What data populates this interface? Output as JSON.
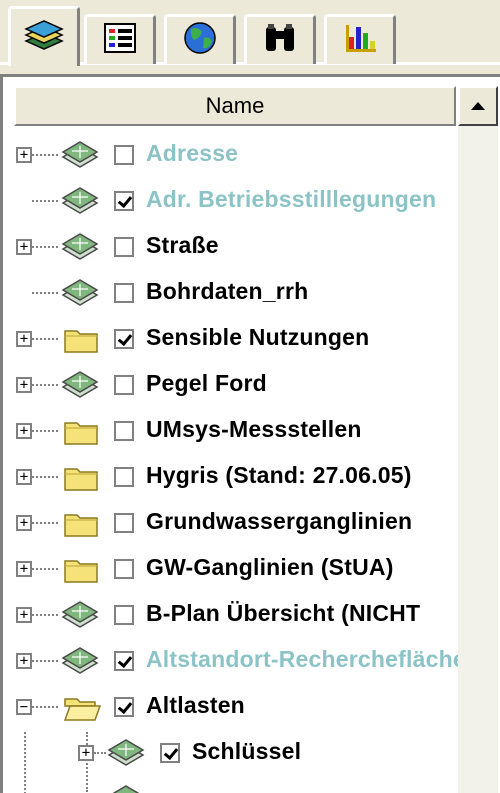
{
  "tabs": [
    {
      "icon": "layers-icon",
      "active": true
    },
    {
      "icon": "legend-list-icon",
      "active": false
    },
    {
      "icon": "globe-icon",
      "active": false
    },
    {
      "icon": "binoculars-icon",
      "active": false
    },
    {
      "icon": "bar-chart-icon",
      "active": false
    }
  ],
  "header": {
    "name_label": "Name"
  },
  "layers": [
    {
      "label": "Adresse",
      "type": "layer",
      "checked": false,
      "expandable": true,
      "greyed": true,
      "indent": 0
    },
    {
      "label": "Adr. Betriebsstilllegungen",
      "type": "layer",
      "checked": true,
      "expandable": false,
      "greyed": true,
      "indent": 0
    },
    {
      "label": "Straße",
      "type": "layer",
      "checked": false,
      "expandable": true,
      "greyed": false,
      "indent": 0
    },
    {
      "label": "Bohrdaten_rrh",
      "type": "layer",
      "checked": false,
      "expandable": false,
      "greyed": false,
      "indent": 0
    },
    {
      "label": "Sensible Nutzungen",
      "type": "folder",
      "checked": true,
      "expandable": true,
      "greyed": false,
      "indent": 0
    },
    {
      "label": "Pegel Ford",
      "type": "layer",
      "checked": false,
      "expandable": true,
      "greyed": false,
      "indent": 0
    },
    {
      "label": "UMsys-Messstellen",
      "type": "folder",
      "checked": false,
      "expandable": true,
      "greyed": false,
      "indent": 0
    },
    {
      "label": "Hygris (Stand: 27.06.05)",
      "type": "folder",
      "checked": false,
      "expandable": true,
      "greyed": false,
      "indent": 0
    },
    {
      "label": "Grundwasserganglinien",
      "type": "folder",
      "checked": false,
      "expandable": true,
      "greyed": false,
      "indent": 0
    },
    {
      "label": "GW-Ganglinien (StUA)",
      "type": "folder",
      "checked": false,
      "expandable": true,
      "greyed": false,
      "indent": 0
    },
    {
      "label": "B-Plan Übersicht (NICHT",
      "type": "layer",
      "checked": false,
      "expandable": true,
      "greyed": false,
      "indent": 0
    },
    {
      "label": "Altstandort-Recherchefläche",
      "type": "layer",
      "checked": true,
      "expandable": true,
      "greyed": true,
      "indent": 0
    },
    {
      "label": "Altlasten",
      "type": "open-folder",
      "checked": true,
      "expandable": true,
      "expanded": true,
      "greyed": false,
      "indent": 0
    },
    {
      "label": "Schlüssel",
      "type": "layer",
      "checked": true,
      "expandable": true,
      "greyed": false,
      "indent": 1
    }
  ],
  "colors": {
    "greyed_label": "#8cc3c6",
    "folder": "#f5e37a",
    "layer_green": "#7fb77e"
  }
}
